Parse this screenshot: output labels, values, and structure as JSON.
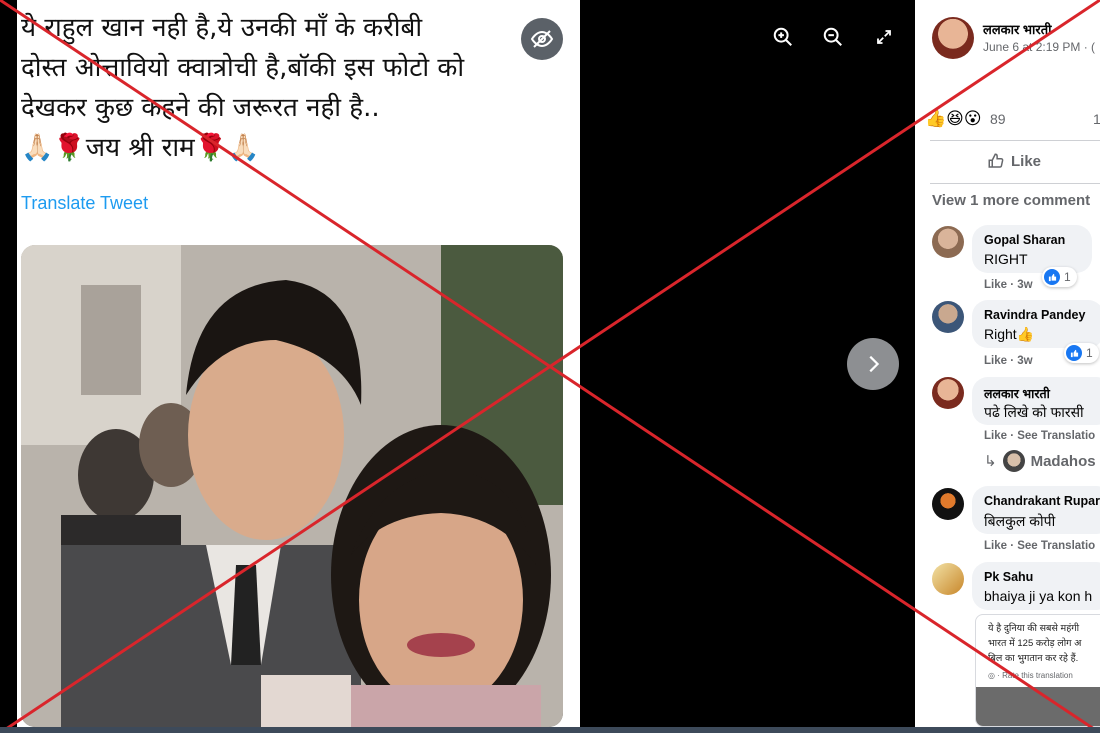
{
  "tweet": {
    "lines": [
      "ये राहुल खान नही है,ये उनकी माँ के करीबी",
      "दोस्त ओत्तावियो क्वात्रोची है,बॉकी इस फोटो को",
      "देखकर कुछ कहने की जरूरत नही है..",
      "🙏🏻🌹जय श्री राम🌹🙏🏻"
    ],
    "translate_label": "Translate Tweet"
  },
  "viewer": {
    "icons": [
      "zoom-in-icon",
      "zoom-out-icon",
      "fullscreen-icon",
      "eye-off-icon",
      "chevron-right-icon"
    ]
  },
  "post": {
    "author": "ललकार भारती",
    "timestamp": "June 6 at 2:19 PM · (",
    "reactions": {
      "emojis": "👍😆😮",
      "count": "89",
      "trailing": "1"
    },
    "like_label": "Like",
    "view_more": "View 1 more comment"
  },
  "comments": [
    {
      "name": "Gopal Sharan",
      "text": "RIGHT",
      "meta": "Like · 3w",
      "reactions": "1"
    },
    {
      "name": "Ravindra Pandey",
      "text": "Right👍",
      "meta": "Like · 3w",
      "reactions": "1"
    },
    {
      "name": "ललकार भारती",
      "text": "पढे लिखे को फारसी",
      "meta": "Like · See Translatio",
      "reply": "Madahos"
    },
    {
      "name": "Chandrakant Rupar",
      "text": "बिलकुल कोपी",
      "meta": "Like · See Translatio"
    },
    {
      "name": "Pk Sahu",
      "text": "bhaiya ji ya kon h"
    }
  ],
  "shared_preview": {
    "lines": [
      "ये है दुनिया की सबसे महंगी",
      "भारत में 125 करोड़ लोग अ",
      "बिल का भुगतान कर रहे हैं."
    ],
    "footer": "◎ · Rate this translation"
  },
  "colors": {
    "strike": "#d9252b",
    "link": "#1d9bf0",
    "fb_blue": "#1877f2",
    "bubble": "#f0f2f5"
  }
}
